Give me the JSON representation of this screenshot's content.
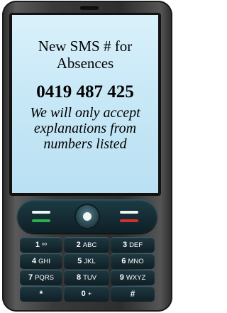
{
  "screen": {
    "title": "New SMS # for Absences",
    "number": "0419 487 425",
    "note": "We will only accept explanations from numbers listed"
  },
  "nav": {
    "call_color": "#27b34a",
    "end_color": "#d82e2e"
  },
  "keypad": [
    {
      "digit": "1",
      "letters": "ᵒᵒ"
    },
    {
      "digit": "2",
      "letters": "ABC"
    },
    {
      "digit": "3",
      "letters": "DEF"
    },
    {
      "digit": "4",
      "letters": "GHI"
    },
    {
      "digit": "5",
      "letters": "JKL"
    },
    {
      "digit": "6",
      "letters": "MNO"
    },
    {
      "digit": "7",
      "letters": "PQRS"
    },
    {
      "digit": "8",
      "letters": "TUV"
    },
    {
      "digit": "9",
      "letters": "WXYZ"
    },
    {
      "digit": "*",
      "letters": ""
    },
    {
      "digit": "0",
      "letters": "+"
    },
    {
      "digit": "#",
      "letters": ""
    }
  ]
}
